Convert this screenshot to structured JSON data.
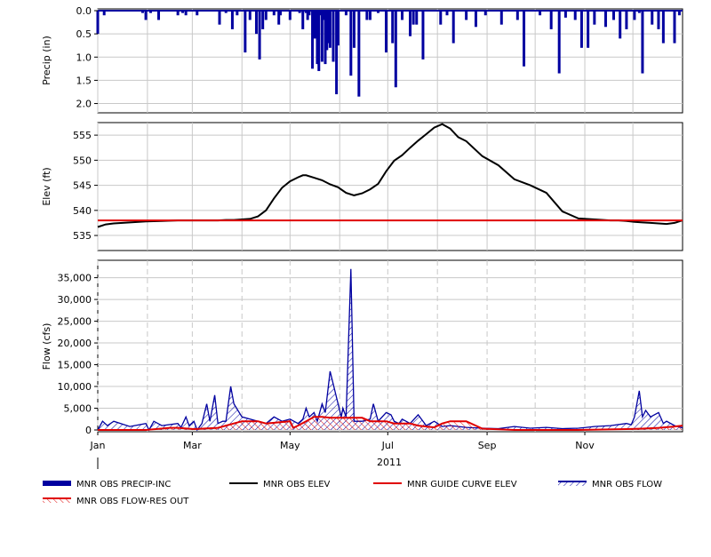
{
  "chart_data": [
    {
      "type": "bar",
      "ylabel": "Precip (in)",
      "ylim": [
        0,
        2.2
      ],
      "inverted": true,
      "yticks": [
        0.0,
        0.5,
        1.0,
        1.5,
        2.0
      ],
      "ytick_labels": [
        "0.0",
        "0.5",
        "1.0",
        "1.5",
        "2.0"
      ],
      "grid": true,
      "color": "#0000a0",
      "series": [
        {
          "name": "MNR OBS PRECIP-INC",
          "x": [
            0,
            4,
            28,
            30,
            33,
            38,
            50,
            53,
            55,
            62,
            76,
            80,
            84,
            87,
            92,
            95,
            99,
            101,
            103,
            105,
            110,
            113,
            114,
            120,
            126,
            128,
            130,
            131,
            132,
            134,
            135,
            136,
            137,
            138,
            139,
            140,
            141,
            142,
            143,
            144,
            145,
            147,
            149,
            150,
            155,
            158,
            160,
            163,
            168,
            170,
            175,
            180,
            184,
            186,
            190,
            195,
            197,
            199,
            203,
            214,
            218,
            222,
            230,
            236,
            242,
            252,
            262,
            266,
            276,
            283,
            288,
            292,
            298,
            302,
            306,
            310,
            317,
            322,
            326,
            330,
            335,
            338,
            340,
            346,
            350,
            353,
            360,
            363
          ],
          "values": [
            0.5,
            0.1,
            0.05,
            0.2,
            0.05,
            0.2,
            0.1,
            0.05,
            0.1,
            0.1,
            0.3,
            0.05,
            0.4,
            0.1,
            0.9,
            0.2,
            0.5,
            1.05,
            0.4,
            0.2,
            0.1,
            0.3,
            0.1,
            0.2,
            0.05,
            0.4,
            0.05,
            0.2,
            0.1,
            1.25,
            0.6,
            0.6,
            1.15,
            1.3,
            0.1,
            1.1,
            0.2,
            1.15,
            0.85,
            0.7,
            0.8,
            1.1,
            1.8,
            0.75,
            0.1,
            1.4,
            0.8,
            1.85,
            0.2,
            0.2,
            0.05,
            0.9,
            0.7,
            1.65,
            0.2,
            0.55,
            0.3,
            0.3,
            1.05,
            0.3,
            0.1,
            0.7,
            0.2,
            0.35,
            0.1,
            0.3,
            0.2,
            1.2,
            0.1,
            0.4,
            1.35,
            0.15,
            0.2,
            0.8,
            0.8,
            0.3,
            0.35,
            0.2,
            0.6,
            0.4,
            0.2,
            0.05,
            1.35,
            0.3,
            0.4,
            0.7,
            0.7,
            0.1
          ]
        }
      ]
    },
    {
      "type": "line",
      "ylabel": "Elev (ft)",
      "ylim": [
        532,
        557.5
      ],
      "yticks": [
        535,
        540,
        545,
        550,
        555
      ],
      "ytick_labels": [
        "535",
        "540",
        "545",
        "550",
        "555"
      ],
      "grid": true,
      "series": [
        {
          "name": "MNR OBS ELEV",
          "color": "#000000",
          "x": [
            0,
            5,
            10,
            20,
            30,
            40,
            50,
            55,
            60,
            65,
            70,
            72,
            75,
            80,
            85,
            90,
            95,
            100,
            105,
            110,
            115,
            120,
            125,
            128,
            130,
            135,
            140,
            145,
            150,
            155,
            160,
            165,
            170,
            175,
            180,
            185,
            190,
            195,
            200,
            205,
            210,
            215,
            220,
            225,
            230,
            240,
            250,
            260,
            270,
            280,
            290,
            300,
            310,
            320,
            325,
            330,
            335,
            340,
            345,
            350,
            355,
            360,
            365
          ],
          "values": [
            536.7,
            537.2,
            537.4,
            537.6,
            537.8,
            537.9,
            538.0,
            538.0,
            538.0,
            538.0,
            538.0,
            538.0,
            538.0,
            538.1,
            538.1,
            538.2,
            538.3,
            538.8,
            540.0,
            542.4,
            544.5,
            545.8,
            546.6,
            547.0,
            547.0,
            546.5,
            546.0,
            545.2,
            544.6,
            543.5,
            543.0,
            543.4,
            544.2,
            545.3,
            547.8,
            549.9,
            551.0,
            552.5,
            553.9,
            555.2,
            556.5,
            557.2,
            556.3,
            554.6,
            553.8,
            550.8,
            549.0,
            546.2,
            545.0,
            543.5,
            539.8,
            538.4,
            538.2,
            538.0,
            538.0,
            537.9,
            537.7,
            537.6,
            537.5,
            537.4,
            537.3,
            537.5,
            538.0
          ]
        },
        {
          "name": "MNR GUIDE CURVE ELEV",
          "color": "#e00000",
          "x": [
            0,
            365
          ],
          "values": [
            538.0,
            538.0
          ]
        }
      ]
    },
    {
      "type": "area",
      "ylabel": "Flow (cfs)",
      "xlabel": "2011",
      "ylim": [
        0,
        39000
      ],
      "yticks": [
        0,
        5000,
        10000,
        15000,
        20000,
        25000,
        30000,
        35000
      ],
      "ytick_labels": [
        "0",
        "5,000",
        "10,000",
        "15,000",
        "20,000",
        "25,000",
        "30,000",
        "35,000"
      ],
      "x_ticks_days": [
        0,
        59,
        120,
        181,
        243,
        304
      ],
      "x_tick_labels": [
        "Jan",
        "Mar",
        "May",
        "Jul",
        "Sep",
        "Nov"
      ],
      "x_minor_days": [
        31,
        90,
        151,
        212,
        273,
        334
      ],
      "grid": true,
      "series": [
        {
          "name": "MNR OBS FLOW",
          "color": "#0000a0",
          "x": [
            0,
            3,
            6,
            10,
            20,
            30,
            32,
            35,
            40,
            50,
            52,
            55,
            57,
            60,
            62,
            65,
            68,
            70,
            73,
            75,
            78,
            80,
            83,
            85,
            90,
            95,
            100,
            105,
            110,
            115,
            120,
            125,
            128,
            130,
            132,
            135,
            137,
            140,
            142,
            145,
            148,
            150,
            152,
            153,
            155,
            158,
            160,
            165,
            170,
            172,
            175,
            180,
            183,
            185,
            188,
            190,
            195,
            200,
            205,
            210,
            215,
            220,
            230,
            240,
            250,
            260,
            270,
            280,
            290,
            300,
            305,
            310,
            320,
            330,
            333,
            335,
            338,
            340,
            342,
            345,
            350,
            353,
            355,
            360,
            365
          ],
          "values": [
            0,
            2000,
            1000,
            2000,
            800,
            1500,
            0,
            2000,
            1000,
            1500,
            600,
            3000,
            1000,
            2000,
            0,
            1500,
            6000,
            2000,
            8000,
            1500,
            2000,
            2000,
            10000,
            6000,
            3000,
            2500,
            2000,
            1500,
            3000,
            2000,
            2500,
            1500,
            2500,
            5000,
            3000,
            4000,
            2000,
            6000,
            4000,
            13500,
            9000,
            6000,
            3000,
            5000,
            3000,
            37000,
            2000,
            2000,
            2500,
            6000,
            2000,
            4000,
            3500,
            2000,
            1500,
            2500,
            1500,
            3500,
            1000,
            2000,
            800,
            1000,
            600,
            400,
            300,
            800,
            400,
            600,
            300,
            400,
            600,
            800,
            1000,
            1500,
            1200,
            3000,
            9000,
            3000,
            4500,
            3000,
            4000,
            1500,
            2000,
            1000,
            500
          ]
        },
        {
          "name": "MNR OBS FLOW-RES OUT",
          "color": "#e00000",
          "x": [
            0,
            30,
            45,
            50,
            60,
            75,
            80,
            90,
            95,
            100,
            105,
            120,
            122,
            125,
            130,
            135,
            140,
            145,
            150,
            155,
            160,
            165,
            170,
            175,
            180,
            185,
            190,
            195,
            200,
            210,
            215,
            220,
            230,
            240,
            260,
            300,
            330,
            340,
            350,
            360,
            365
          ],
          "values": [
            0,
            0,
            500,
            500,
            200,
            500,
            1000,
            2000,
            2000,
            2000,
            1500,
            2000,
            500,
            1000,
            2000,
            3000,
            3000,
            2800,
            2800,
            2800,
            2800,
            2800,
            2000,
            2000,
            2000,
            1500,
            1500,
            1500,
            1000,
            600,
            1500,
            2000,
            2000,
            300,
            0,
            0,
            200,
            300,
            500,
            800,
            1000
          ]
        }
      ]
    }
  ],
  "legend": [
    {
      "name": "MNR OBS PRECIP-INC",
      "color": "#0000a0",
      "style": "thick"
    },
    {
      "name": "MNR OBS ELEV",
      "color": "#000000",
      "style": "line"
    },
    {
      "name": "MNR GUIDE CURVE ELEV",
      "color": "#e00000",
      "style": "line"
    },
    {
      "name": "MNR OBS FLOW",
      "color": "#0000a0",
      "style": "hatch"
    },
    {
      "name": "MNR OBS FLOW-RES OUT",
      "color": "#e00000",
      "style": "hatch"
    }
  ]
}
